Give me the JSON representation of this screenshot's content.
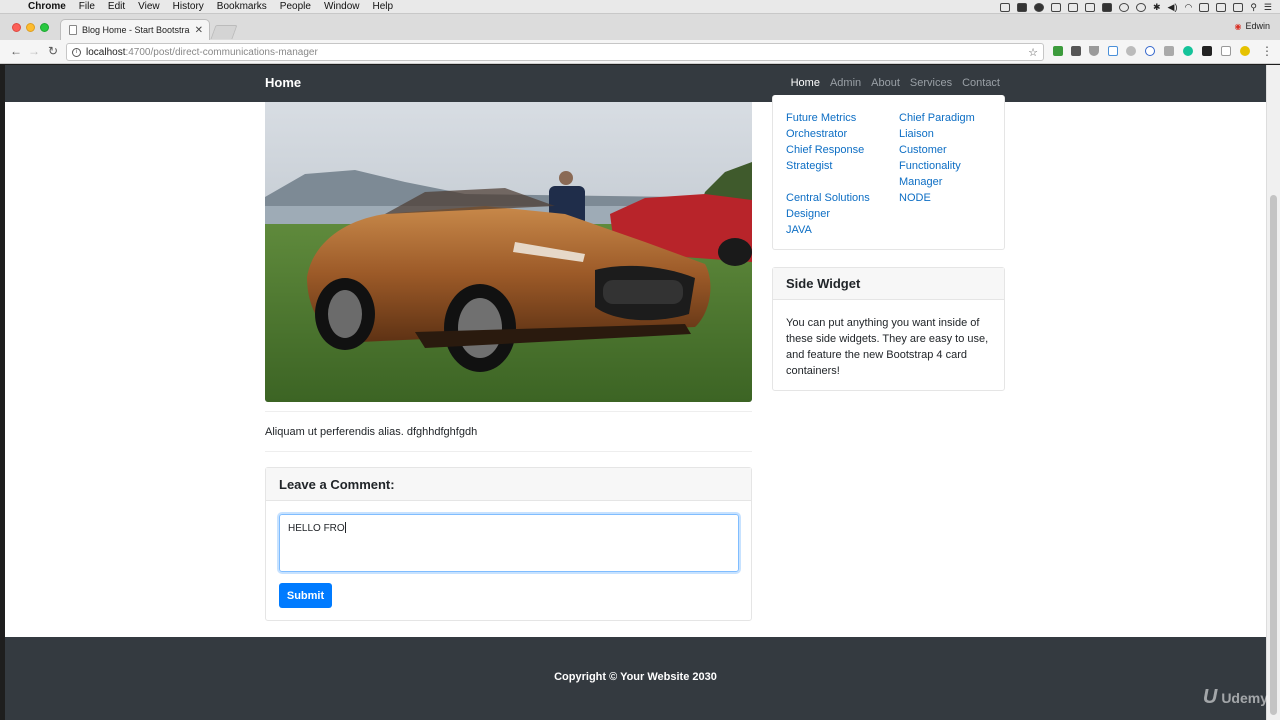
{
  "os_menubar": {
    "app": "Chrome",
    "items": [
      "File",
      "Edit",
      "View",
      "History",
      "Bookmarks",
      "People",
      "Window",
      "Help"
    ]
  },
  "browser": {
    "tab_title": "Blog Home - Start Bootstrap T",
    "profile_name": "Edwin",
    "url_host": "localhost",
    "url_path": ":4700/post/direct-communications-manager"
  },
  "site": {
    "brand": "Home",
    "nav": [
      {
        "label": "Home",
        "active": true
      },
      {
        "label": "Admin",
        "active": false
      },
      {
        "label": "About",
        "active": false
      },
      {
        "label": "Services",
        "active": false
      },
      {
        "label": "Contact",
        "active": false
      }
    ]
  },
  "post": {
    "excerpt": "Aliquam ut perferendis alias. dfghhdfghfgdh"
  },
  "comment": {
    "header": "Leave a Comment:",
    "value": "HELLO FRO",
    "submit_label": "Submit"
  },
  "categories": {
    "left": [
      "Future Metrics",
      "Orchestrator",
      "Chief Response",
      "Strategist",
      "",
      "Central Solutions",
      "Designer",
      "JAVA"
    ],
    "right": [
      "Chief Paradigm",
      "Liaison",
      "Customer",
      "Functionality",
      "Manager",
      "NODE"
    ]
  },
  "side_widget": {
    "title": "Side Widget",
    "body": "You can put anything you want inside of these side widgets. They are easy to use, and feature the new Bootstrap 4 card containers!"
  },
  "footer": {
    "copyright": "Copyright © Your Website 2030"
  },
  "watermark": {
    "mark": "U",
    "text": "Udemy"
  },
  "colors": {
    "navbar": "#343a40",
    "link": "#0d6ec4",
    "primary": "#007bff"
  }
}
